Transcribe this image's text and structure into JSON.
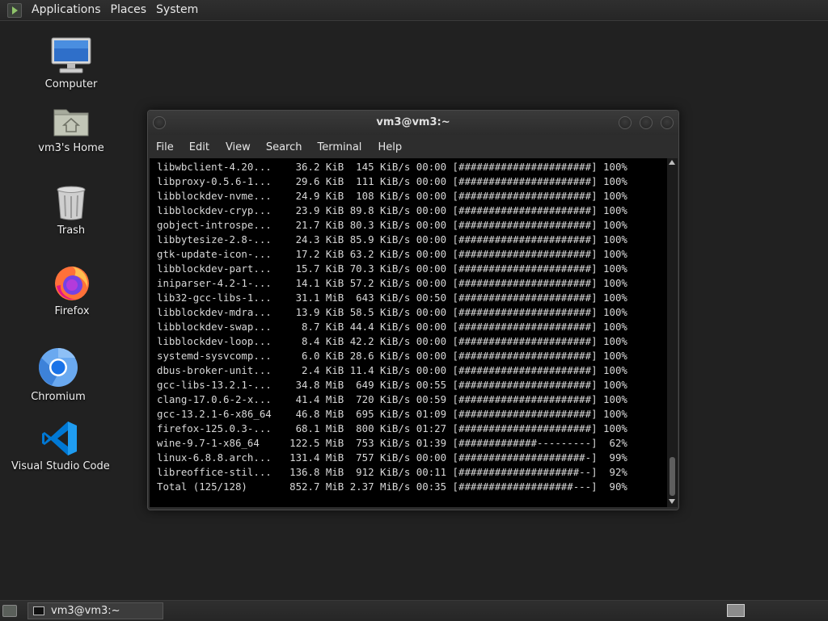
{
  "top_panel": {
    "menus": [
      "Applications",
      "Places",
      "System"
    ]
  },
  "desktop_icons": [
    {
      "label": "Computer",
      "icon": "computer-icon"
    },
    {
      "label": "vm3's Home",
      "icon": "home-folder-icon"
    },
    {
      "label": "Trash",
      "icon": "trash-icon"
    },
    {
      "label": "Firefox",
      "icon": "firefox-icon"
    },
    {
      "label": "Chromium",
      "icon": "chromium-icon"
    },
    {
      "label": "Visual Studio Code",
      "icon": "vscode-icon"
    }
  ],
  "terminal": {
    "title": "vm3@vm3:~",
    "menus": [
      "File",
      "Edit",
      "View",
      "Search",
      "Terminal",
      "Help"
    ],
    "lines": [
      {
        "name": "libwbclient-4.20...",
        "size": "36.2 KiB",
        "speed": "145 KiB/s",
        "time": "00:00",
        "bar": "[######################]",
        "percent": "100%"
      },
      {
        "name": "libproxy-0.5.6-1...",
        "size": "29.6 KiB",
        "speed": "111 KiB/s",
        "time": "00:00",
        "bar": "[######################]",
        "percent": "100%"
      },
      {
        "name": "libblockdev-nvme...",
        "size": "24.9 KiB",
        "speed": "108 KiB/s",
        "time": "00:00",
        "bar": "[######################]",
        "percent": "100%"
      },
      {
        "name": "libblockdev-cryp...",
        "size": "23.9 KiB",
        "speed": "89.8 KiB/s",
        "time": "00:00",
        "bar": "[######################]",
        "percent": "100%"
      },
      {
        "name": "gobject-introspe...",
        "size": "21.7 KiB",
        "speed": "80.3 KiB/s",
        "time": "00:00",
        "bar": "[######################]",
        "percent": "100%"
      },
      {
        "name": "libbytesize-2.8-...",
        "size": "24.3 KiB",
        "speed": "85.9 KiB/s",
        "time": "00:00",
        "bar": "[######################]",
        "percent": "100%"
      },
      {
        "name": "gtk-update-icon-...",
        "size": "17.2 KiB",
        "speed": "63.2 KiB/s",
        "time": "00:00",
        "bar": "[######################]",
        "percent": "100%"
      },
      {
        "name": "libblockdev-part...",
        "size": "15.7 KiB",
        "speed": "70.3 KiB/s",
        "time": "00:00",
        "bar": "[######################]",
        "percent": "100%"
      },
      {
        "name": "iniparser-4.2-1-...",
        "size": "14.1 KiB",
        "speed": "57.2 KiB/s",
        "time": "00:00",
        "bar": "[######################]",
        "percent": "100%"
      },
      {
        "name": "lib32-gcc-libs-1...",
        "size": "31.1 MiB",
        "speed": "643 KiB/s",
        "time": "00:50",
        "bar": "[######################]",
        "percent": "100%"
      },
      {
        "name": "libblockdev-mdra...",
        "size": "13.9 KiB",
        "speed": "58.5 KiB/s",
        "time": "00:00",
        "bar": "[######################]",
        "percent": "100%"
      },
      {
        "name": "libblockdev-swap...",
        "size": "8.7 KiB",
        "speed": "44.4 KiB/s",
        "time": "00:00",
        "bar": "[######################]",
        "percent": "100%"
      },
      {
        "name": "libblockdev-loop...",
        "size": "8.4 KiB",
        "speed": "42.2 KiB/s",
        "time": "00:00",
        "bar": "[######################]",
        "percent": "100%"
      },
      {
        "name": "systemd-sysvcomp...",
        "size": "6.0 KiB",
        "speed": "28.6 KiB/s",
        "time": "00:00",
        "bar": "[######################]",
        "percent": "100%"
      },
      {
        "name": "dbus-broker-unit...",
        "size": "2.4 KiB",
        "speed": "11.4 KiB/s",
        "time": "00:00",
        "bar": "[######################]",
        "percent": "100%"
      },
      {
        "name": "gcc-libs-13.2.1-...",
        "size": "34.8 MiB",
        "speed": "649 KiB/s",
        "time": "00:55",
        "bar": "[######################]",
        "percent": "100%"
      },
      {
        "name": "clang-17.0.6-2-x...",
        "size": "41.4 MiB",
        "speed": "720 KiB/s",
        "time": "00:59",
        "bar": "[######################]",
        "percent": "100%"
      },
      {
        "name": "gcc-13.2.1-6-x86_64",
        "size": "46.8 MiB",
        "speed": "695 KiB/s",
        "time": "01:09",
        "bar": "[######################]",
        "percent": "100%"
      },
      {
        "name": "firefox-125.0.3-...",
        "size": "68.1 MiB",
        "speed": "800 KiB/s",
        "time": "01:27",
        "bar": "[######################]",
        "percent": "100%"
      },
      {
        "name": "wine-9.7-1-x86_64",
        "size": "122.5 MiB",
        "speed": "753 KiB/s",
        "time": "01:39",
        "bar": "[#############---------]",
        "percent": "62%"
      },
      {
        "name": "linux-6.8.8.arch...",
        "size": "131.4 MiB",
        "speed": "757 KiB/s",
        "time": "00:00",
        "bar": "[#####################-]",
        "percent": "99%"
      },
      {
        "name": "libreoffice-stil...",
        "size": "136.8 MiB",
        "speed": "912 KiB/s",
        "time": "00:11",
        "bar": "[####################--]",
        "percent": "92%"
      },
      {
        "name": "Total (125/128)",
        "size": "852.7 MiB",
        "speed": "2.37 MiB/s",
        "time": "00:35",
        "bar": "[###################---]",
        "percent": "90%"
      }
    ]
  },
  "taskbar": {
    "task_label": "vm3@vm3:~"
  },
  "colors": {
    "desktop_bg": "#212121",
    "terminal_bg": "#000000",
    "terminal_fg": "#d8d8d8"
  }
}
